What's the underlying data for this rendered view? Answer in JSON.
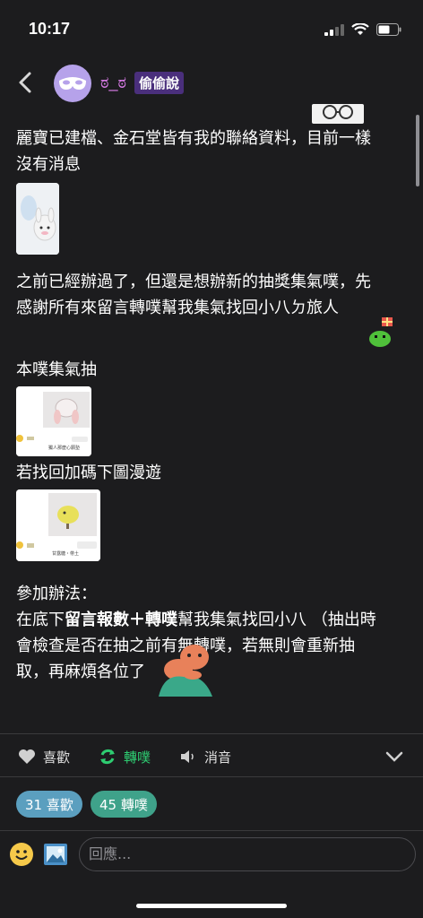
{
  "status": {
    "time": "10:17"
  },
  "header": {
    "nickname": "ಠ_ಠ",
    "badge": "偷偷說"
  },
  "post": {
    "line1": "麗寶已建檔、金石堂皆有我的聯絡資料，目前一樣",
    "line2": "沒有消息",
    "para2_line1": "之前已經辦過了，但還是想辦新的抽獎集氣噗，先",
    "para2_line2": "感謝所有來留言轉噗幫我集氣找回小八ㄉ旅人",
    "section1": "本噗集氣抽",
    "card1_caption": "獨人那麼心願墊",
    "section2": "若找回加碼下圖漫遊",
    "card2_caption": "甘露糖・帶土",
    "rules_title": "參加辦法：",
    "rules_prefix": "在底下",
    "rules_bold": "留言報數＋轉噗",
    "rules_suffix": "幫我集氣找回小八 （抽出時",
    "rules_line2": "會檢查是否在抽之前有無轉噗，若無則會重新抽",
    "rules_line3": "取，再麻煩各位了"
  },
  "actions": {
    "like": "喜歡",
    "replurk": "轉噗",
    "mute": "消音"
  },
  "stats": {
    "likes": "31 喜歡",
    "replurks": "45 轉噗"
  },
  "reply": {
    "placeholder": "回應..."
  },
  "colors": {
    "like_pill": "#5b9fbf",
    "replurk_pill": "#3fa28a",
    "replurk_icon": "#2ecc71",
    "nick": "#d57ae3"
  }
}
